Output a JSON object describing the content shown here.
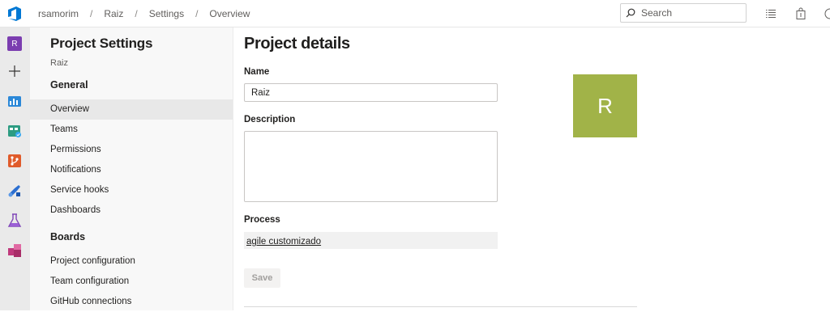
{
  "breadcrumb": [
    "rsamorim",
    "Raiz",
    "Settings",
    "Overview"
  ],
  "breadcrumb_separator": "/",
  "search": {
    "placeholder": "Search"
  },
  "rail": {
    "project_initial": "R",
    "project_color": "#7b3db0",
    "icons": [
      "new-icon",
      "overview-icon",
      "boards-icon",
      "repos-icon",
      "pipelines-icon",
      "test-plans-icon",
      "artifacts-icon"
    ]
  },
  "nav": {
    "title": "Project Settings",
    "subtitle": "Raiz",
    "groups": [
      {
        "label": "General",
        "items": [
          "Overview",
          "Teams",
          "Permissions",
          "Notifications",
          "Service hooks",
          "Dashboards"
        ]
      },
      {
        "label": "Boards",
        "items": [
          "Project configuration",
          "Team configuration",
          "GitHub connections"
        ]
      }
    ],
    "selected": "Overview"
  },
  "main": {
    "title": "Project details",
    "name_label": "Name",
    "name_value": "Raiz",
    "description_label": "Description",
    "description_value": "",
    "process_label": "Process",
    "process_value": "agile customizado",
    "save_label": "Save",
    "avatar_initial": "R",
    "avatar_color": "#a1b348"
  }
}
